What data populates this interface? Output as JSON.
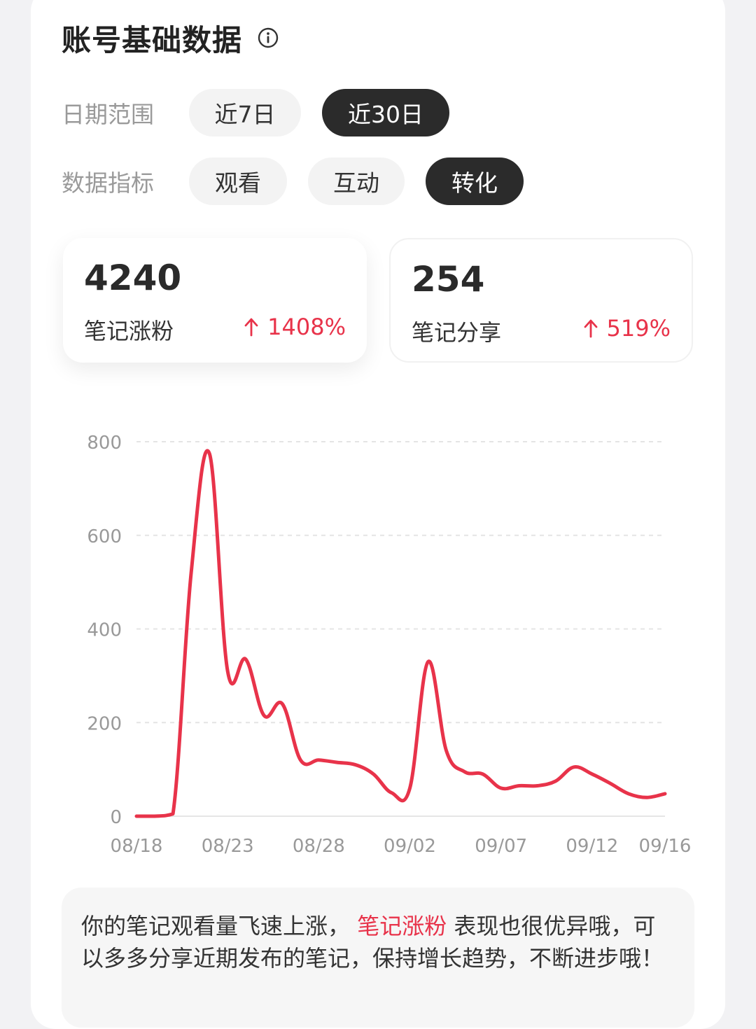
{
  "header": {
    "title": "账号基础数据"
  },
  "filters": {
    "date_range": {
      "label": "日期范围",
      "options": [
        "近7日",
        "近30日"
      ],
      "selected": "近30日"
    },
    "metric": {
      "label": "数据指标",
      "options": [
        "观看",
        "互动",
        "转化"
      ],
      "selected": "转化"
    }
  },
  "stats": [
    {
      "value": "4240",
      "label": "笔记涨粉",
      "change": "1408%",
      "selected": true
    },
    {
      "value": "254",
      "label": "笔记分享",
      "change": "519%",
      "selected": false
    }
  ],
  "colors": {
    "accent": "#e8334a",
    "pill_active": "#2b2b2b",
    "pill_inactive": "#f3f3f3",
    "muted_text": "#9a9a9a"
  },
  "chart_data": {
    "type": "line",
    "title": "",
    "xlabel": "",
    "ylabel": "",
    "ylim": [
      0,
      800
    ],
    "yticks": [
      0,
      200,
      400,
      600,
      800
    ],
    "xtick_labels": [
      "08/18",
      "08/23",
      "08/28",
      "09/02",
      "09/07",
      "09/12",
      "09/16"
    ],
    "grid": true,
    "legend": "none",
    "series": [
      {
        "name": "",
        "x": [
          "08/18",
          "08/19",
          "08/20",
          "08/21",
          "08/22",
          "08/23",
          "08/24",
          "08/25",
          "08/26",
          "08/27",
          "08/28",
          "08/29",
          "08/30",
          "08/31",
          "09/01",
          "09/02",
          "09/03",
          "09/04",
          "09/05",
          "09/06",
          "09/07",
          "09/08",
          "09/09",
          "09/10",
          "09/11",
          "09/12",
          "09/13",
          "09/14",
          "09/15",
          "09/16"
        ],
        "y": [
          0,
          0,
          5,
          520,
          775,
          310,
          335,
          215,
          240,
          120,
          120,
          115,
          110,
          90,
          50,
          60,
          330,
          140,
          95,
          90,
          60,
          65,
          65,
          75,
          105,
          90,
          70,
          48,
          40,
          48
        ]
      }
    ]
  },
  "tip": {
    "text_before": "你的笔记观看量飞速上涨，",
    "highlight": "笔记涨粉",
    "text_after": "表现也很优异哦，可以多多分享近期发布的笔记，保持增长趋势，不断进步哦！"
  }
}
